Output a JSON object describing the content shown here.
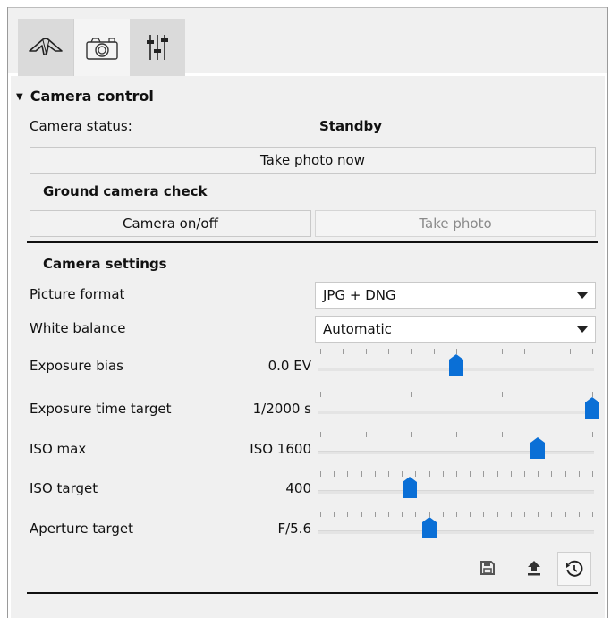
{
  "tabs": [
    {
      "name": "aircraft",
      "icon": "aircraft-icon"
    },
    {
      "name": "camera",
      "icon": "camera-icon"
    },
    {
      "name": "settings",
      "icon": "sliders-icon"
    }
  ],
  "camera_control": {
    "title": "Camera control",
    "status_label": "Camera status:",
    "status_value": "Standby",
    "take_photo_now": "Take photo now"
  },
  "ground_check": {
    "title": "Ground camera check",
    "camera_onoff": "Camera on/off",
    "take_photo": "Take photo"
  },
  "settings": {
    "title": "Camera settings",
    "picture_format": {
      "label": "Picture format",
      "value": "JPG + DNG"
    },
    "white_balance": {
      "label": "White balance",
      "value": "Automatic"
    },
    "exposure_bias": {
      "label": "Exposure bias",
      "value": "0.0 EV",
      "position": 0.5,
      "ticks": 12
    },
    "exposure_time": {
      "label": "Exposure time target",
      "value": "1/2000 s",
      "position": 1.0,
      "ticks": 3
    },
    "iso_max": {
      "label": "ISO max",
      "value": "ISO 1600",
      "position": 0.8,
      "ticks": 6
    },
    "iso_target": {
      "label": "ISO target",
      "value": "400",
      "position": 0.33,
      "ticks": 20
    },
    "aperture_target": {
      "label": "Aperture target",
      "value": "F/5.6",
      "position": 0.4,
      "ticks": 20
    }
  },
  "toolbar_icons": [
    "save-icon",
    "upload-icon",
    "restore-icon"
  ],
  "colors": {
    "accent": "#0a6fd6",
    "panel_bg": "#f0f0f0",
    "tab_active_bg": "#f4f4f4",
    "tab_inactive_bg": "#dadada"
  }
}
